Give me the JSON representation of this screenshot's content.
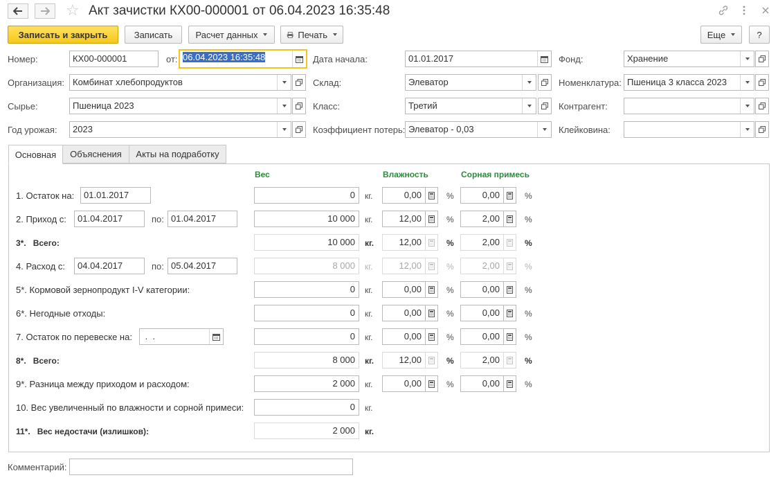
{
  "window": {
    "title": "Акт зачистки КХ00-000001 от 06.04.2023 16:35:48"
  },
  "toolbar": {
    "save_close": "Записать и закрыть",
    "save": "Записать",
    "calc": "Расчет данных",
    "print": "Печать",
    "more": "Еще",
    "help": "?"
  },
  "header": {
    "number_label": "Номер:",
    "number_value": "КХ00-000001",
    "from_label": "от:",
    "from_value": "06.04.2023 16:35:48",
    "start_label": "Дата начала:",
    "start_value": "01.01.2017",
    "fund_label": "Фонд:",
    "fund_value": "Хранение",
    "org_label": "Организация:",
    "org_value": "Комбинат хлебопродуктов",
    "warehouse_label": "Склад:",
    "warehouse_value": "Элеватор",
    "nomen_label": "Номенклатура:",
    "nomen_value": "Пшеница 3 класса 2023",
    "raw_label": "Сырье:",
    "raw_value": "Пшеница 2023",
    "class_label": "Класс:",
    "class_value": "Третий",
    "contractor_label": "Контрагент:",
    "contractor_value": "",
    "year_label": "Год урожая:",
    "year_value": "2023",
    "loss_label": "Коэффициент потерь:",
    "loss_value": "Элеватор - 0,03",
    "gluten_label": "Клейковина:",
    "gluten_value": ""
  },
  "tabs": [
    "Основная",
    "Объяснения",
    "Акты на подработку"
  ],
  "columns": {
    "weight": "Вес",
    "moisture": "Влажность",
    "impurity": "Сорная примесь"
  },
  "rows": {
    "r1": {
      "label": "1.  Остаток на:",
      "date": "01.01.2017",
      "weight": "0",
      "moisture": "0,00",
      "impurity": "0,00"
    },
    "r2": {
      "label": "2.  Приход с:",
      "date_from": "01.04.2017",
      "to_label": "по:",
      "date_to": "01.04.2017",
      "weight": "10 000",
      "moisture": "12,00",
      "impurity": "2,00"
    },
    "r3": {
      "num": "3*.",
      "label": "Всего:",
      "weight": "10 000",
      "moisture": "12,00",
      "impurity": "2,00"
    },
    "r4": {
      "label": "4.  Расход с:",
      "date_from": "04.04.2017",
      "to_label": "по:",
      "date_to": "05.04.2017",
      "weight": "8 000",
      "moisture": "12,00",
      "impurity": "2,00"
    },
    "r5": {
      "label": "5*.  Кормовой зернопродукт I-V категории:",
      "weight": "0",
      "moisture": "0,00",
      "impurity": "0,00"
    },
    "r6": {
      "label": "6*.  Негодные отходы:",
      "weight": "0",
      "moisture": "0,00",
      "impurity": "0,00"
    },
    "r7": {
      "label": "7.  Остаток по перевеске на:",
      "date": " .  .",
      "weight": "0",
      "moisture": "0,00",
      "impurity": "0,00"
    },
    "r8": {
      "num": "8*.",
      "label": "Всего:",
      "weight": "8 000",
      "moisture": "12,00",
      "impurity": "2,00"
    },
    "r9": {
      "label": "9*.  Разница между приходом и расходом:",
      "weight": "2 000",
      "moisture": "0,00",
      "impurity": "0,00"
    },
    "r10": {
      "label": "10.  Вес увеличенный по влажности и сорной примеси:",
      "weight": "0"
    },
    "r11": {
      "num": "11*.",
      "label": "Вес недостачи (излишков):",
      "weight": "2 000"
    }
  },
  "units": {
    "kg": "кг.",
    "pct": "%"
  },
  "comment": {
    "label": "Комментарий:",
    "value": ""
  }
}
